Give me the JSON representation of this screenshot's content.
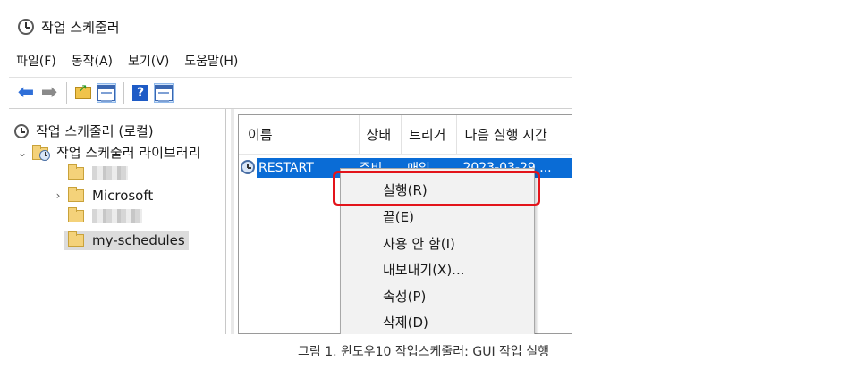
{
  "window": {
    "title": "작업 스케줄러"
  },
  "menubar": [
    "파일(F)",
    "동작(A)",
    "보기(V)",
    "도움말(H)"
  ],
  "toolbar": {
    "buttons": [
      "back-arrow-icon",
      "forward-arrow-icon",
      "up-folder-icon",
      "show-pane-icon",
      "help-icon",
      "show-action-pane-icon"
    ]
  },
  "tree": {
    "root": "작업 스케줄러 (로컬)",
    "library": "작업 스케줄러 라이브러리",
    "children": [
      "",
      "Microsoft",
      "",
      "my-schedules"
    ]
  },
  "list": {
    "columns": [
      "이름",
      "상태",
      "트리거",
      "다음 실행 시간"
    ],
    "rows": [
      {
        "name": "RESTART",
        "status": "준비",
        "trigger": "매일",
        "next_run": "2023-03-29 ..."
      }
    ]
  },
  "context_menu": {
    "items": [
      "실행(R)",
      "끝(E)",
      "사용 안 함(I)",
      "내보내기(X)...",
      "속성(P)",
      "삭제(D)"
    ],
    "highlighted_index": 0
  },
  "colors": {
    "selection": "#0a6cd6",
    "highlight_box": "#e3141b"
  },
  "caption": "그림 1. 윈도우10 작업스케줄러: GUI 작업 실행"
}
